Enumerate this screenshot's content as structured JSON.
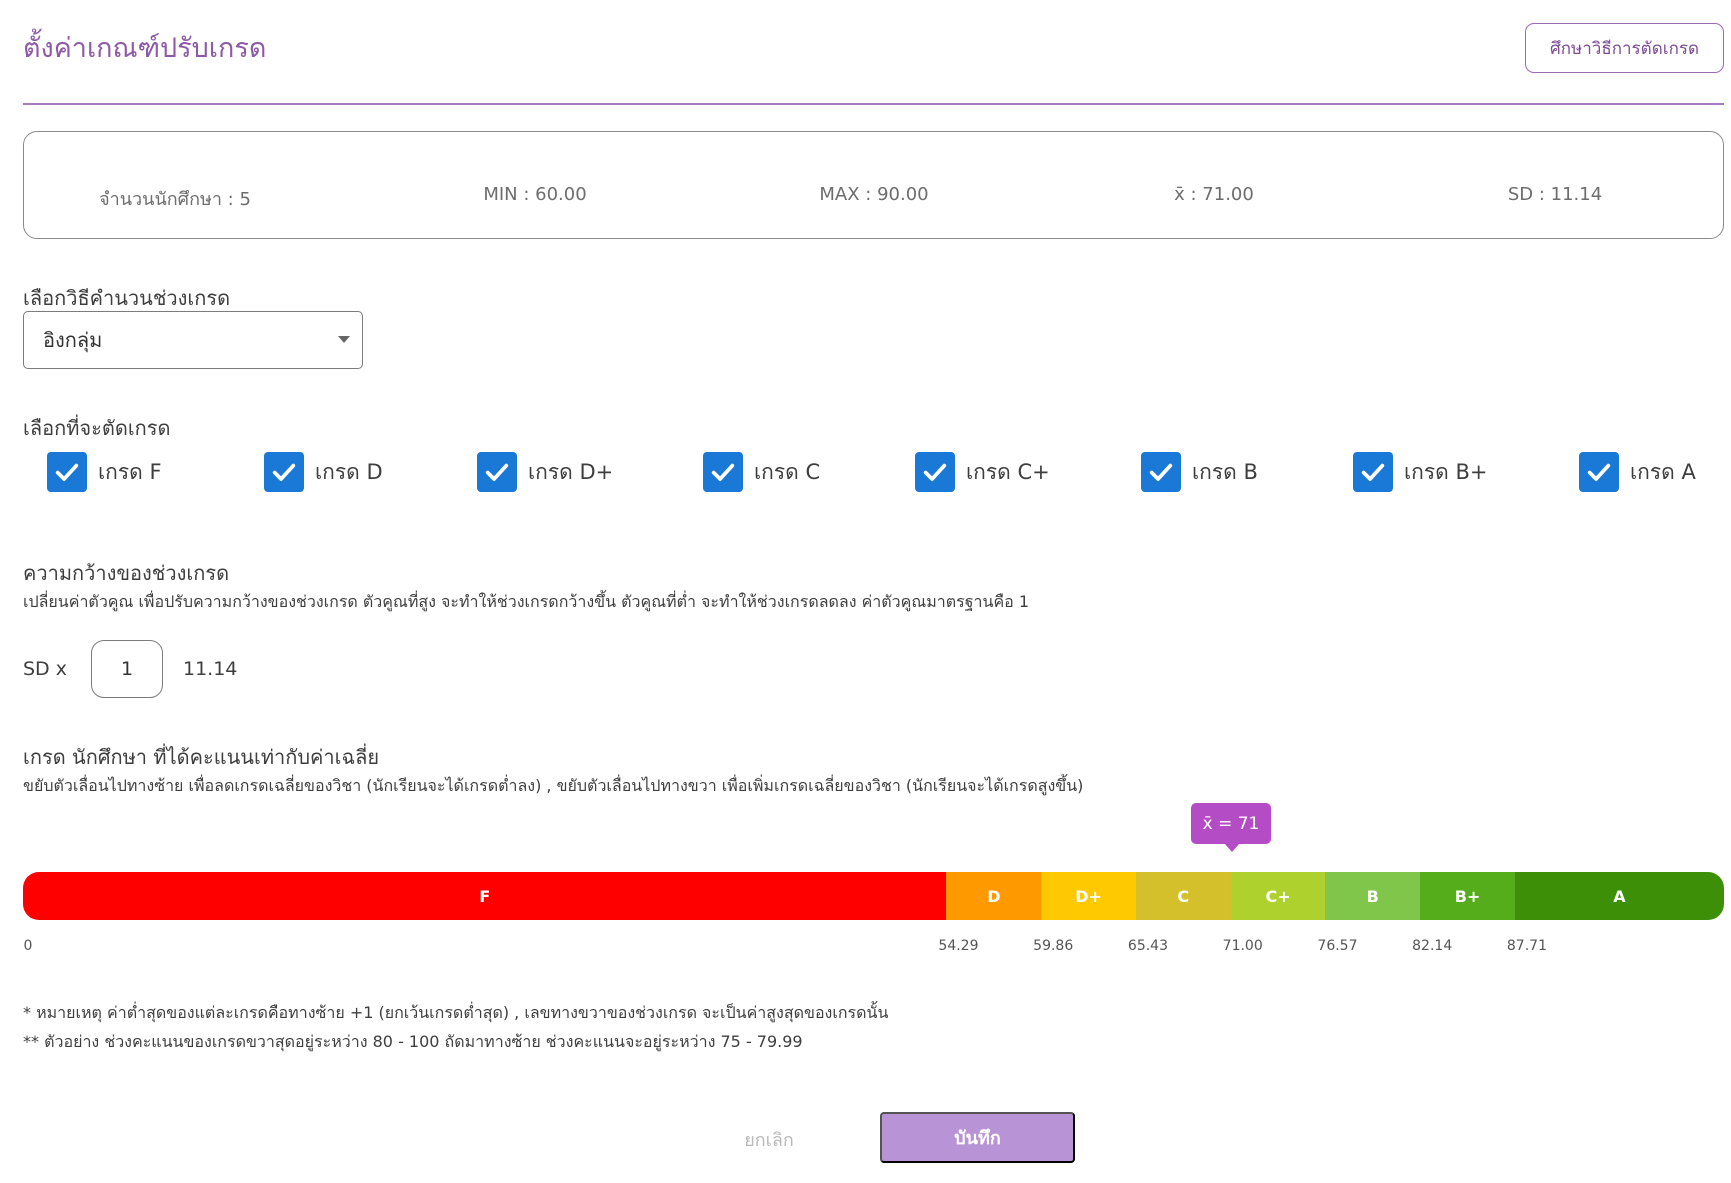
{
  "header": {
    "title": "ตั้งค่าเกณฑ์ปรับเกรด",
    "study_button": "ศึกษาวิธีการตัดเกรด"
  },
  "stats": {
    "students": "จำนวนนักศึกษา : 5",
    "min": "MIN : 60.00",
    "max": "MAX : 90.00",
    "mean": "x̄ : 71.00",
    "sd": "SD : 11.14"
  },
  "method": {
    "label": "เลือกวิธีคำนวนช่วงเกรด",
    "selected": "อิงกลุ่ม"
  },
  "grades_select": {
    "label": "เลือกที่จะตัดเกรด",
    "items": [
      {
        "label": "เกรด F",
        "checked": true
      },
      {
        "label": "เกรด D",
        "checked": true
      },
      {
        "label": "เกรด D+",
        "checked": true
      },
      {
        "label": "เกรด C",
        "checked": true
      },
      {
        "label": "เกรด C+",
        "checked": true
      },
      {
        "label": "เกรด B",
        "checked": true
      },
      {
        "label": "เกรด B+",
        "checked": true
      },
      {
        "label": "เกรด A",
        "checked": true
      }
    ]
  },
  "width": {
    "label": "ความกว้างของช่วงเกรด",
    "description": "เปลี่ยนค่าตัวคูณ เพื่อปรับความกว้างของช่วงเกรด ตัวคูณที่สูง จะทำให้ช่วงเกรดกว้างขึ้น ตัวคูณที่ต่ำ จะทำให้ช่วงเกรดลดลง ค่าตัวคูณมาตรฐานคือ 1",
    "sd_prefix": "SD x",
    "multiplier": "1",
    "sd_value": "11.14"
  },
  "mean_grade": {
    "label": "เกรด นักศึกษา ที่ได้คะแนนเท่ากับค่าเฉลี่ย",
    "description": "ขยับตัวเลื่อนไปทางซ้าย เพื่อลดเกรดเฉลี่ยของวิชา (นักเรียนจะได้เกรดต่ำลง) , ขยับตัวเลื่อนไปทางขวา เพื่อเพิ่มเกรดเฉลี่ยของวิชา (นักเรียนจะได้เกรดสูงขึ้น)",
    "tooltip": "x̄ = 71",
    "mean_value": 71
  },
  "grade_bar": {
    "segments": [
      {
        "label": "F",
        "from": 0,
        "to": 54.29,
        "color": "#ff0000"
      },
      {
        "label": "D",
        "from": 54.29,
        "to": 59.86,
        "color": "#ff9900"
      },
      {
        "label": "D+",
        "from": 59.86,
        "to": 65.43,
        "color": "#ffc900"
      },
      {
        "label": "C",
        "from": 65.43,
        "to": 71.0,
        "color": "#d4c02a"
      },
      {
        "label": "C+",
        "from": 71.0,
        "to": 76.57,
        "color": "#afd12d"
      },
      {
        "label": "B",
        "from": 76.57,
        "to": 82.14,
        "color": "#80c64a"
      },
      {
        "label": "B+",
        "from": 82.14,
        "to": 87.71,
        "color": "#56ad1c"
      },
      {
        "label": "A",
        "from": 87.71,
        "to": 100,
        "color": "#3e8f08"
      }
    ],
    "ticks": [
      "0",
      "54.29",
      "59.86",
      "65.43",
      "71.00",
      "76.57",
      "82.14",
      "87.71"
    ]
  },
  "notes": {
    "note1": "* หมายเหตุ ค่าต่ำสุดของแต่ละเกรดคือทางซ้าย +1 (ยกเว้นเกรดต่ำสุด) , เลขทางขวาของช่วงเกรด จะเป็นค่าสูงสุดของเกรดนั้น",
    "note2": "** ตัวอย่าง ช่วงคะแนนของเกรดขวาสุดอยู่ระหว่าง 80 - 100 ถัดมาทางซ้าย ช่วงคะแนนจะอยู่ระหว่าง 75 - 79.99"
  },
  "footer": {
    "cancel": "ยกเลิก",
    "save": "บันทึก"
  }
}
